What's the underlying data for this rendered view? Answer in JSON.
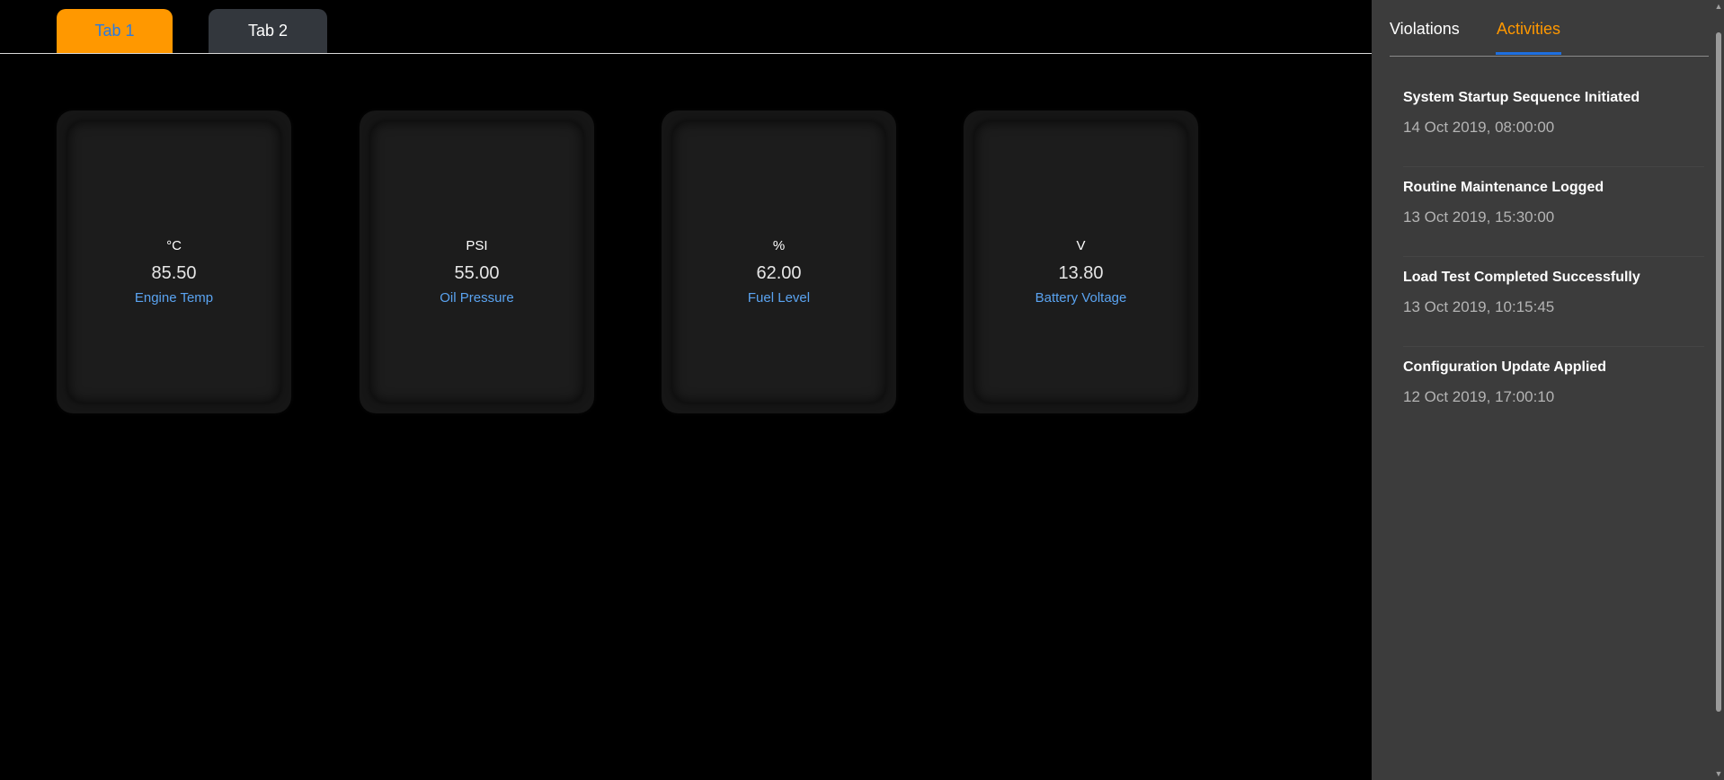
{
  "main": {
    "tabs": [
      {
        "label": "Tab 1",
        "active": true
      },
      {
        "label": "Tab 2",
        "active": false
      }
    ],
    "cards": [
      {
        "unit": "°C",
        "value": "85.50",
        "label": "Engine Temp"
      },
      {
        "unit": "PSI",
        "value": "55.00",
        "label": "Oil Pressure"
      },
      {
        "unit": "%",
        "value": "62.00",
        "label": "Fuel Level"
      },
      {
        "unit": "V",
        "value": "13.80",
        "label": "Battery Voltage"
      }
    ]
  },
  "panel": {
    "tabs": [
      {
        "label": "Violations",
        "active": false
      },
      {
        "label": "Activities",
        "active": true
      }
    ],
    "activities": [
      {
        "title": "System Startup Sequence Initiated",
        "time": "14 Oct 2019, 08:00:00"
      },
      {
        "title": "Routine Maintenance Logged",
        "time": "13 Oct 2019, 15:30:00"
      },
      {
        "title": "Load Test Completed Successfully",
        "time": "13 Oct 2019, 10:15:45"
      },
      {
        "title": "Configuration Update Applied",
        "time": "12 Oct 2019, 17:00:10"
      }
    ]
  },
  "colors": {
    "accent": "#ff9800",
    "link_blue": "#5aa3f0",
    "active_underline": "#1e6fe0",
    "panel_bg": "#3c3c3c",
    "card_bg": "#1c1c1c"
  },
  "icons": {
    "scroll_up": "scroll-up-arrow-icon",
    "scroll_down": "scroll-down-arrow-icon"
  }
}
